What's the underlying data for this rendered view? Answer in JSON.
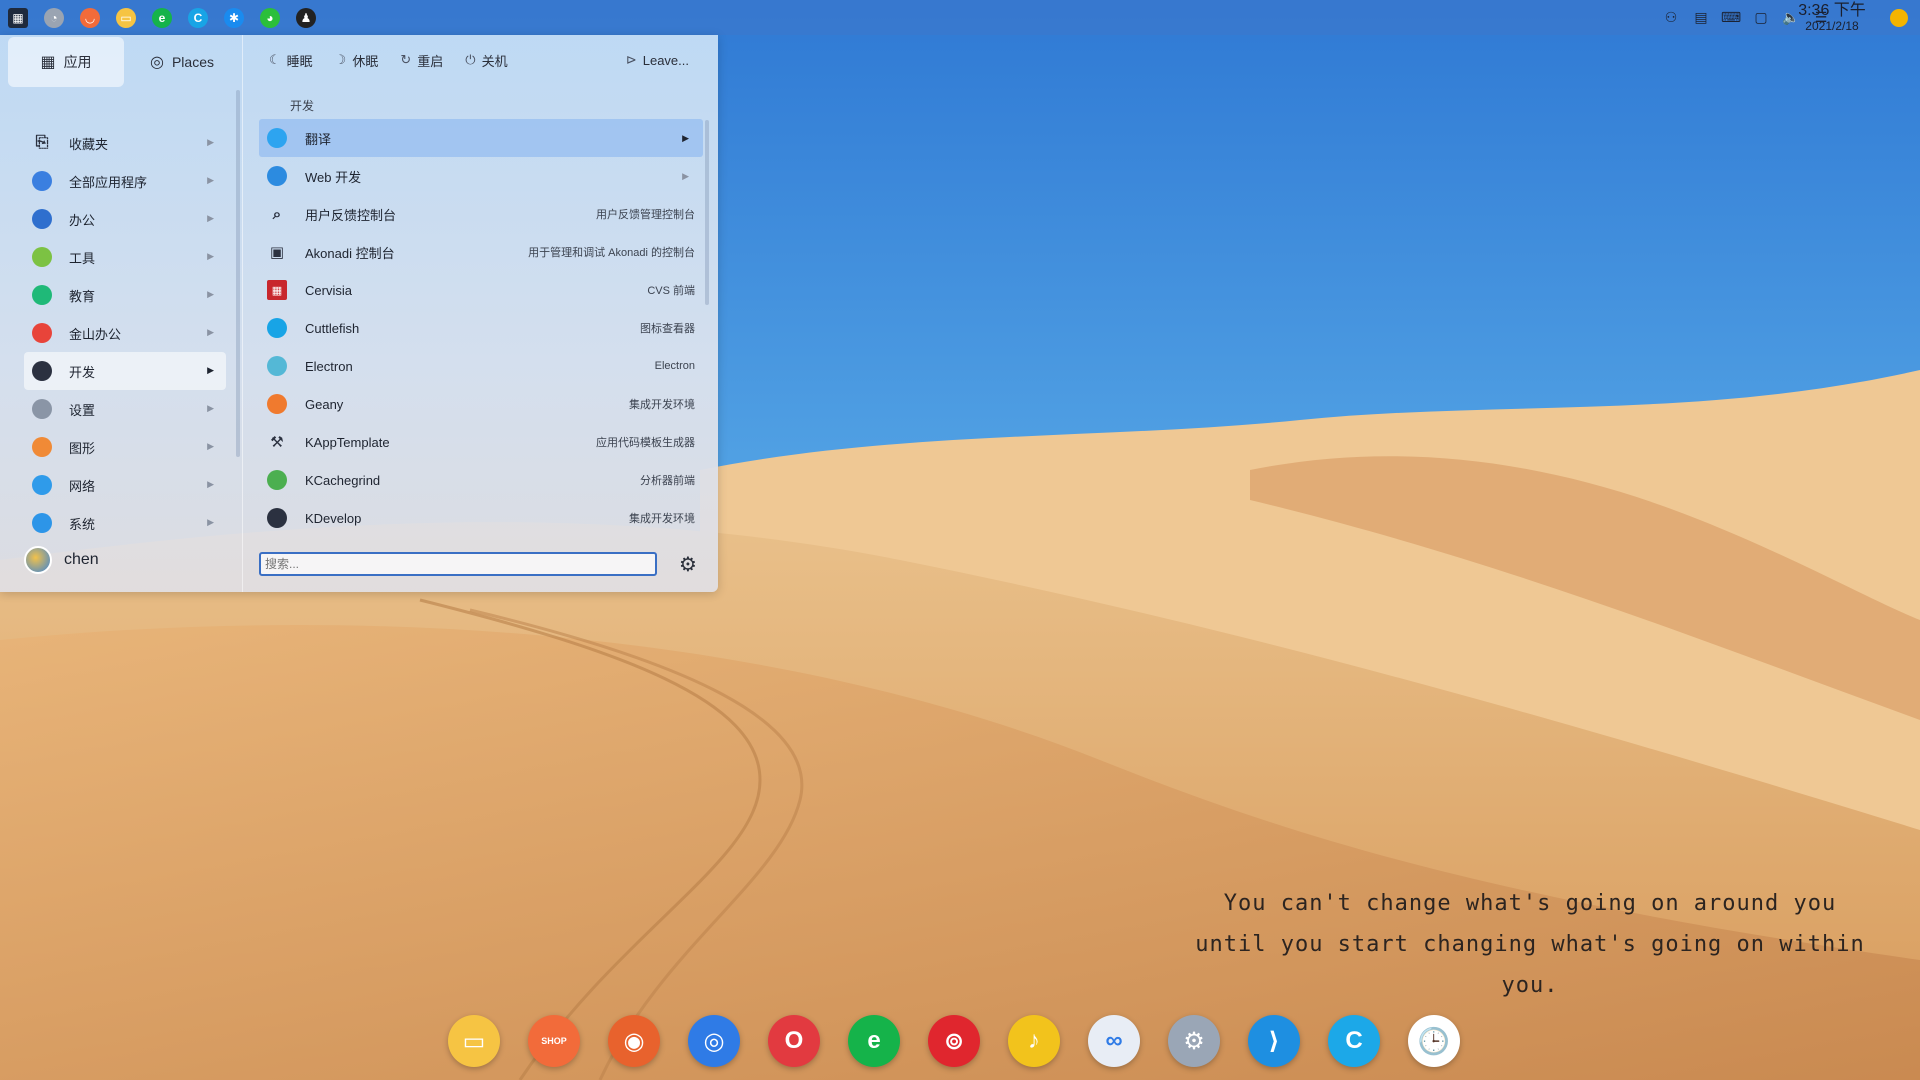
{
  "top_panel": {
    "apps": [
      {
        "name": "launcher",
        "icon": "grid-icon",
        "color": "#1f2a3d"
      },
      {
        "name": "system-monitor",
        "icon": "gauge-icon",
        "color": "#9aa4b2"
      },
      {
        "name": "shop",
        "icon": "bag-icon",
        "color": "#f26b3a"
      },
      {
        "name": "files",
        "icon": "folder-icon",
        "color": "#f6c443"
      },
      {
        "name": "browser-e",
        "icon": "edge-e-icon",
        "color": "#15b34a"
      },
      {
        "name": "cuttlefish",
        "icon": "c-icon",
        "color": "#18a4e6"
      },
      {
        "name": "feeds",
        "icon": "star-icon",
        "color": "#1a8bef"
      },
      {
        "name": "wechat",
        "icon": "wechat-icon",
        "color": "#2bbf3a"
      },
      {
        "name": "qq",
        "icon": "penguin-icon",
        "color": "#222222"
      }
    ],
    "clock": {
      "time": "3:36 下午",
      "date": "2021/2/18"
    },
    "tray": [
      "user-switch-icon",
      "clipboard-icon",
      "keyboard-icon",
      "device-icon",
      "volume-icon",
      "list-icon"
    ]
  },
  "launcher": {
    "tabs": [
      {
        "label": "应用",
        "icon": "apps-grid-icon",
        "active": true
      },
      {
        "label": "Places",
        "icon": "compass-icon",
        "active": false
      }
    ],
    "categories": [
      {
        "label": "收藏夹",
        "icon": "bookmark-icon",
        "color": "#2b3140",
        "active": false
      },
      {
        "label": "全部应用程序",
        "icon": "all-apps-icon",
        "color": "#3a7fe0",
        "active": false
      },
      {
        "label": "办公",
        "icon": "office-icon",
        "color": "#2f6fce",
        "active": false
      },
      {
        "label": "工具",
        "icon": "tools-icon",
        "color": "#7cc243",
        "active": false
      },
      {
        "label": "教育",
        "icon": "education-icon",
        "color": "#1fb978",
        "active": false
      },
      {
        "label": "金山办公",
        "icon": "wps-icon",
        "color": "#e8443a",
        "active": false
      },
      {
        "label": "开发",
        "icon": "develop-icon",
        "color": "#2b3140",
        "active": true
      },
      {
        "label": "设置",
        "icon": "settings-icon",
        "color": "#8a95a6",
        "active": false
      },
      {
        "label": "图形",
        "icon": "graphics-icon",
        "color": "#f08a36",
        "active": false
      },
      {
        "label": "网络",
        "icon": "network-icon",
        "color": "#2f9bea",
        "active": false
      },
      {
        "label": "系统",
        "icon": "system-icon",
        "color": "#2d95e8",
        "active": false
      }
    ],
    "user_name": "chen",
    "power": [
      {
        "label": "睡眠",
        "icon": "moon-icon"
      },
      {
        "label": "休眠",
        "icon": "hibernate-icon"
      },
      {
        "label": "重启",
        "icon": "restart-icon"
      },
      {
        "label": "关机",
        "icon": "power-icon"
      }
    ],
    "leave_label": "Leave...",
    "section_title": "开发",
    "apps": [
      {
        "name": "翻译",
        "desc": "",
        "submenu": true,
        "active": true,
        "icon": "translate-icon",
        "color": "#2da4f0"
      },
      {
        "name": "Web 开发",
        "desc": "",
        "submenu": true,
        "active": false,
        "icon": "web-dev-icon",
        "color": "#2c8be0"
      },
      {
        "name": "用户反馈控制台",
        "desc": "用户反馈管理控制台",
        "submenu": false,
        "active": false,
        "icon": "search-icon",
        "color": "transparent"
      },
      {
        "name": "Akonadi 控制台",
        "desc": "用于管理和调试 Akonadi 的控制台",
        "submenu": false,
        "active": false,
        "icon": "terminal-icon",
        "color": "transparent"
      },
      {
        "name": "Cervisia",
        "desc": "CVS 前端",
        "submenu": false,
        "active": false,
        "icon": "cervisia-icon",
        "color": "#c8272d"
      },
      {
        "name": "Cuttlefish",
        "desc": "图标查看器",
        "submenu": false,
        "active": false,
        "icon": "cuttlefish-icon",
        "color": "#18a4e6"
      },
      {
        "name": "Electron",
        "desc": "Electron",
        "submenu": false,
        "active": false,
        "icon": "electron-icon",
        "color": "#54b8d6"
      },
      {
        "name": "Geany",
        "desc": "集成开发环境",
        "submenu": false,
        "active": false,
        "icon": "geany-icon",
        "color": "#f07a2e"
      },
      {
        "name": "KAppTemplate",
        "desc": "应用代码模板生成器",
        "submenu": false,
        "active": false,
        "icon": "kapptemplate-icon",
        "color": "transparent"
      },
      {
        "name": "KCachegrind",
        "desc": "分析器前端",
        "submenu": false,
        "active": false,
        "icon": "kcachegrind-icon",
        "color": "#4caf50"
      },
      {
        "name": "KDevelop",
        "desc": "集成开发环境",
        "submenu": false,
        "active": false,
        "icon": "kdevelop-icon",
        "color": "#2b3140"
      }
    ],
    "search_placeholder": "搜索..."
  },
  "quote_lines": [
    "You can't change what's going on around you",
    "until you start changing what's going on within you."
  ],
  "dock": [
    {
      "name": "files",
      "icon": "folder-icon",
      "color": "#f6c443",
      "glyph": "▭"
    },
    {
      "name": "shop",
      "icon": "shop-bag-icon",
      "color": "#f26b3a",
      "glyph": "SHOP"
    },
    {
      "name": "firefox",
      "icon": "firefox-icon",
      "color": "#e8622d",
      "glyph": "◉"
    },
    {
      "name": "chrome",
      "icon": "chrome-icon",
      "color": "#2f7be6",
      "glyph": "◎"
    },
    {
      "name": "opera",
      "icon": "opera-icon",
      "color": "#e23a40",
      "glyph": "O"
    },
    {
      "name": "browser-e",
      "icon": "edge-e-icon",
      "color": "#15b34a",
      "glyph": "e"
    },
    {
      "name": "netease-music",
      "icon": "music-icon",
      "color": "#e0262e",
      "glyph": "⊚"
    },
    {
      "name": "qq-music",
      "icon": "note-icon",
      "color": "#f2c31c",
      "glyph": "♪"
    },
    {
      "name": "baidu-netdisk",
      "icon": "cloud-icon",
      "color": "#e8edf5",
      "glyph": "∞"
    },
    {
      "name": "system-settings",
      "icon": "gear-icon",
      "color": "#9aa6b6",
      "glyph": "⚙"
    },
    {
      "name": "vscode",
      "icon": "vscode-icon",
      "color": "#1e8fe1",
      "glyph": "⟩"
    },
    {
      "name": "cuttlefish",
      "icon": "c-icon",
      "color": "#1ca8e8",
      "glyph": "C"
    },
    {
      "name": "clock",
      "icon": "clock-icon",
      "color": "#ffffff",
      "glyph": "🕒"
    }
  ]
}
